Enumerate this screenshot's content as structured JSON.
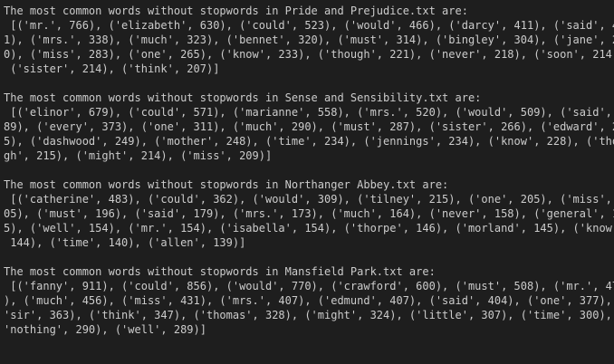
{
  "terminal": {
    "blocks": [
      {
        "lines": [
          "The most common words without stopwords in Pride and Prejudice.txt are:",
          " [('mr.', 766), ('elizabeth', 630), ('could', 523), ('would', 466), ('darcy', 411), ('said', 40",
          "1), ('mrs.', 338), ('much', 323), ('bennet', 320), ('must', 314), ('bingley', 304), ('jane', 29",
          "0), ('miss', 283), ('one', 265), ('know', 233), ('though', 221), ('never', 218), ('soon', 214),",
          " ('sister', 214), ('think', 207)]"
        ]
      },
      {
        "lines": [
          "The most common words without stopwords in Sense and Sensibility.txt are:",
          " [('elinor', 679), ('could', 571), ('marianne', 558), ('mrs.', 520), ('would', 509), ('said', 3",
          "89), ('every', 373), ('one', 311), ('much', 290), ('must', 287), ('sister', 266), ('edward', 25",
          "5), ('dashwood', 249), ('mother', 248), ('time', 234), ('jennings', 234), ('know', 228), ('thou",
          "gh', 215), ('might', 214), ('miss', 209)]"
        ]
      },
      {
        "lines": [
          "The most common words without stopwords in Northanger Abbey.txt are:",
          " [('catherine', 483), ('could', 362), ('would', 309), ('tilney', 215), ('one', 205), ('miss', 2",
          "05), ('must', 196), ('said', 179), ('mrs.', 173), ('much', 164), ('never', 158), ('general', 15",
          "5), ('well', 154), ('mr.', 154), ('isabella', 154), ('thorpe', 146), ('morland', 145), ('know',",
          " 144), ('time', 140), ('allen', 139)]"
        ]
      },
      {
        "lines": [
          "The most common words without stopwords in Mansfield Park.txt are:",
          " [('fanny', 911), ('could', 856), ('would', 770), ('crawford', 600), ('must', 508), ('mr.', 470",
          "), ('much', 456), ('miss', 431), ('mrs.', 407), ('edmund', 407), ('said', 404), ('one', 377), (",
          "'sir', 363), ('think', 347), ('thomas', 328), ('might', 324), ('little', 307), ('time', 300), (",
          "'nothing', 290), ('well', 289)]"
        ]
      }
    ]
  },
  "colors": {
    "background": "#1e1e1e",
    "text": "#cccccc"
  }
}
